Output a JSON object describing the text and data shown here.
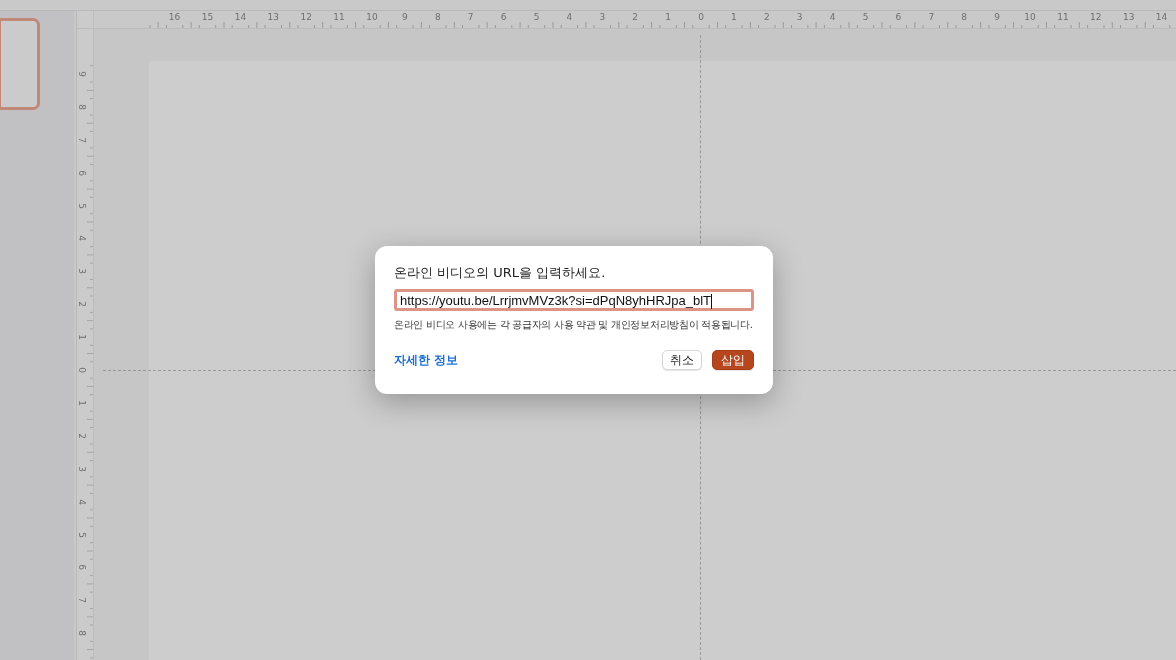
{
  "slide_thumbnails": [
    {
      "selected": true
    }
  ],
  "rulers": {
    "horizontal": [
      "16",
      "15",
      "14",
      "13",
      "12",
      "11",
      "10",
      "9",
      "8",
      "7",
      "6",
      "5",
      "4",
      "3",
      "2",
      "1",
      "0",
      "1",
      "2",
      "3",
      "4",
      "5",
      "6",
      "7",
      "8",
      "9",
      "10",
      "11",
      "12",
      "13",
      "14"
    ],
    "vertical": [
      "9",
      "8",
      "7",
      "6",
      "5",
      "4",
      "3",
      "2",
      "1",
      "0",
      "1",
      "2",
      "3",
      "4",
      "5",
      "6",
      "7",
      "8"
    ]
  },
  "dialog": {
    "prompt": "온라인 비디오의 URL을 입력하세요.",
    "url_field": {
      "value": "https://youtu.be/LrrjmvMVz3k?si=dPqN8yhHRJpa_blT",
      "focused": true
    },
    "note": "온라인 비디오 사용에는 각 공급자의 사용 약관 및 개인정보처리방침이 적용됩니다.",
    "link": "자세한 정보",
    "buttons": [
      {
        "label": "취소",
        "kind": "secondary"
      },
      {
        "label": "삽입",
        "kind": "primary"
      }
    ]
  }
}
